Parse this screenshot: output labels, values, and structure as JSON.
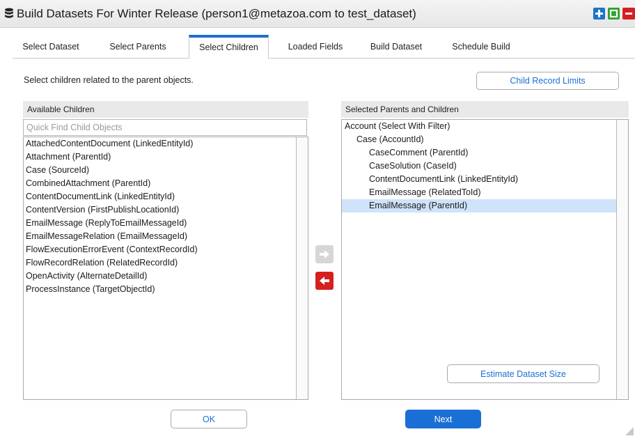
{
  "window": {
    "title": "Build Datasets For Winter Release (person1@metazoa.com to test_dataset)",
    "controls": [
      "plus",
      "square",
      "minus"
    ],
    "colors": {
      "accent": "#1d6fd0",
      "plus": "#1e73c8",
      "square": "#2ea32e",
      "minus": "#d42020"
    }
  },
  "tabs": [
    {
      "label": "Select Dataset",
      "active": false
    },
    {
      "label": "Select Parents",
      "active": false
    },
    {
      "label": "Select Children",
      "active": true
    },
    {
      "label": "Loaded Fields",
      "active": false
    },
    {
      "label": "Build Dataset",
      "active": false
    },
    {
      "label": "Schedule Build",
      "active": false
    }
  ],
  "instructions": "Select children related to the parent objects.",
  "child_record_limits_label": "Child Record Limits",
  "available": {
    "header": "Available Children",
    "search_placeholder": "Quick Find Child Objects",
    "items": [
      "AttachedContentDocument (LinkedEntityId)",
      "Attachment (ParentId)",
      "Case (SourceId)",
      "CombinedAttachment (ParentId)",
      "ContentDocumentLink (LinkedEntityId)",
      "ContentVersion (FirstPublishLocationId)",
      "EmailMessage (ReplyToEmailMessageId)",
      "EmailMessageRelation (EmailMessageId)",
      "FlowExecutionErrorEvent (ContextRecordId)",
      "FlowRecordRelation (RelatedRecordId)",
      "OpenActivity (AlternateDetailId)",
      "ProcessInstance (TargetObjectId)"
    ]
  },
  "selected": {
    "header": "Selected Parents and Children",
    "items": [
      {
        "label": "Account (Select With Filter)",
        "level": 0,
        "selected": false
      },
      {
        "label": "Case (AccountId)",
        "level": 1,
        "selected": false
      },
      {
        "label": "CaseComment (ParentId)",
        "level": 2,
        "selected": false
      },
      {
        "label": "CaseSolution (CaseId)",
        "level": 2,
        "selected": false
      },
      {
        "label": "ContentDocumentLink (LinkedEntityId)",
        "level": 2,
        "selected": false
      },
      {
        "label": "EmailMessage (RelatedToId)",
        "level": 2,
        "selected": false
      },
      {
        "label": "EmailMessage (ParentId)",
        "level": 2,
        "selected": true
      }
    ]
  },
  "estimate_label": "Estimate Dataset Size",
  "ok_label": "OK",
  "next_label": "Next",
  "icons": {
    "add": "arrow-right-icon",
    "remove": "arrow-left-icon",
    "title": "database-icon"
  }
}
